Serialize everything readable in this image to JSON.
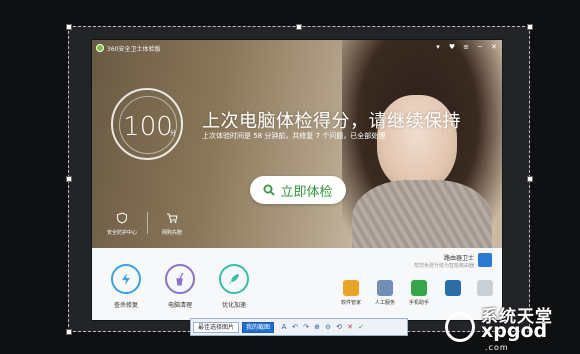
{
  "titlebar": {
    "title": "360安全卫士体验版",
    "controls": [
      "▾",
      "♥",
      "≡",
      "─",
      "✕"
    ]
  },
  "score": {
    "value": "100",
    "unit": "分"
  },
  "headline": "上次电脑体检得分，请继续保持",
  "subline": "上次体验时间是 58 分钟前，共修复 7 个问题，已全部处理",
  "check_button": "立即体检",
  "side_links": [
    {
      "label": "安全防护中心",
      "icon": "shield-icon"
    },
    {
      "label": "网购先赔",
      "icon": "cart-icon"
    }
  ],
  "tools": [
    {
      "label": "查杀修复",
      "icon": "bolt-icon",
      "color": "#3aa3e3"
    },
    {
      "label": "电脑清理",
      "icon": "broom-icon",
      "color": "#8b6fd6"
    },
    {
      "label": "优化加速",
      "icon": "rocket-icon",
      "color": "#35c0a8"
    }
  ],
  "router": {
    "title": "路由器卫士",
    "subtitle": "帮您免费升级为智能路由器"
  },
  "mini_tools": [
    {
      "label": "软件管家",
      "color": "#e9a325"
    },
    {
      "label": "人工服务",
      "color": "#6f8fb8"
    },
    {
      "label": "手机助手",
      "color": "#37a64a"
    },
    {
      "label": "",
      "color": "#2b6ea7"
    },
    {
      "label": "",
      "color": "#c9d0d6"
    }
  ],
  "capture_toolbar": {
    "label": "最佳选择图片",
    "input_value": "我的截图",
    "tools": [
      "A",
      "↶",
      "↷",
      "⊕",
      "⊖",
      "⟲",
      "✕",
      "✓"
    ]
  },
  "watermark": {
    "line1": "系统天堂",
    "line2": "xpgod",
    "line3": ".com"
  }
}
